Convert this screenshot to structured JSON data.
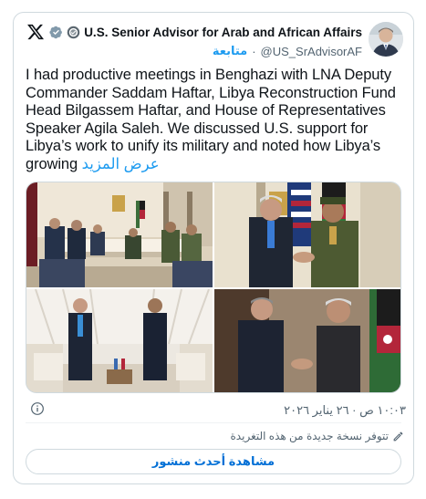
{
  "author": {
    "display_name": "U.S. Senior Advisor for Arab and African Affairs",
    "handle": "@US_SrAdvisorAF",
    "separator": "·",
    "follow_label": "متابعة",
    "verified_badge_icon": "verified-badge-icon",
    "affiliation_icon": "state-department-seal-icon"
  },
  "tweet": {
    "text": "I had productive meetings in Benghazi with LNA Deputy Commander Saddam Haftar, Libya Reconstruction Fund Head Bilgassem Haftar, and House of Representatives Speaker Agila Saleh. We discussed U.S. support for Libya’s work to unify its military and noted how Libya’s growing",
    "show_more_label": "عرض المزيد",
    "timestamp": "١٠:٠٣ ص · ٢٦ يناير ٢٠٢٦"
  },
  "media": {
    "photos": [
      "meeting-room-photo",
      "handshake-flags-photo",
      "standing-leaders-photo",
      "handshake-office-photo"
    ]
  },
  "footer": {
    "notice_text": "تتوفر نسخة جديدة من هذه التغريدة",
    "view_latest_label": "مشاهدة أحدث منشور"
  },
  "colors": {
    "accent": "#1d9bf0",
    "button_text": "#006fd6",
    "secondary_text": "#536471",
    "border": "#cfd9de"
  }
}
